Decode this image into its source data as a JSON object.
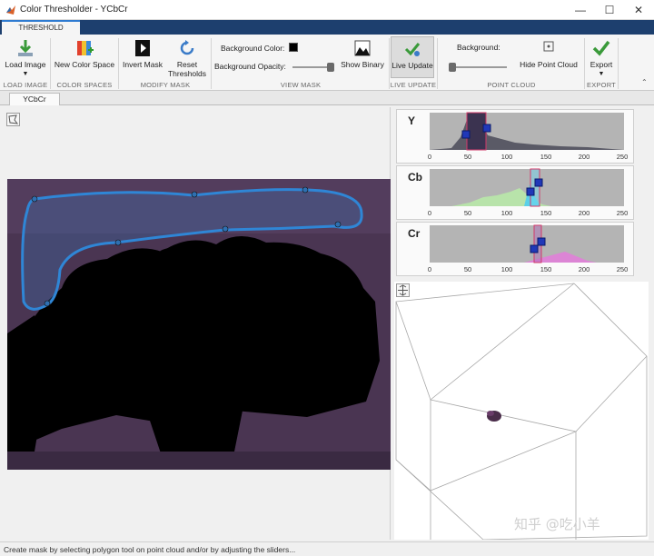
{
  "window": {
    "title": "Color Thresholder - YCbCr",
    "minimize": "—",
    "maximize": "☐",
    "close": "✕"
  },
  "ribbon": {
    "tab_label": "THRESHOLD",
    "tools": {
      "load_image": "Load Image",
      "new_color_space": "New Color Space",
      "invert_mask": "Invert Mask",
      "reset_thresholds_1": "Reset",
      "reset_thresholds_2": "Thresholds",
      "background_color": "Background Color:",
      "background_opacity": "Background Opacity:",
      "show_binary": "Show Binary",
      "live_update": "Live Update",
      "background": "Background:",
      "hide_point_cloud": "Hide Point Cloud",
      "export": "Export"
    },
    "sections": {
      "load_image": "LOAD IMAGE",
      "color_spaces": "COLOR SPACES",
      "modify_mask": "MODIFY MASK",
      "view_mask": "VIEW MASK",
      "live_update": "LIVE UPDATE",
      "point_cloud": "POINT CLOUD",
      "export": "EXPORT"
    },
    "sliders": {
      "background_opacity_fraction": 0.95,
      "point_cloud_background_fraction": 0.0
    },
    "colors": {
      "background_color_swatch": "#000000"
    }
  },
  "document": {
    "tab_label": "YCbCr"
  },
  "channels": [
    {
      "label": "Y",
      "range": [
        47,
        74
      ],
      "ticks": [
        "0",
        "50",
        "100",
        "150",
        "200",
        "250"
      ]
    },
    {
      "label": "Cb",
      "range": [
        133,
        145
      ],
      "ticks": [
        "0",
        "50",
        "100",
        "150",
        "200",
        "250"
      ]
    },
    {
      "label": "Cr",
      "range": [
        135,
        145
      ],
      "ticks": [
        "0",
        "50",
        "100",
        "150",
        "200",
        "250"
      ]
    }
  ],
  "status": {
    "message": "Create mask by selecting polygon tool on point cloud and/or by adjusting the sliders..."
  },
  "watermark": "知乎 @吃小羊"
}
